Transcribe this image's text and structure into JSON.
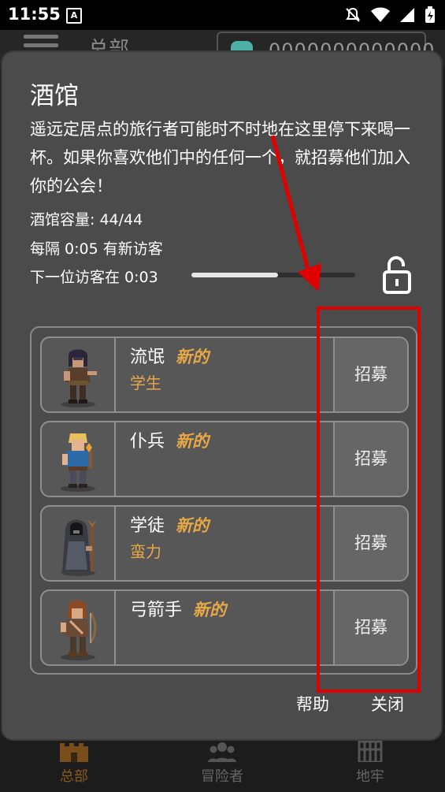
{
  "status_bar": {
    "time": "11:55",
    "a_icon": "A"
  },
  "background": {
    "title": "总部",
    "gems": "0000000000000"
  },
  "bottom_nav": {
    "items": [
      {
        "label": "总部",
        "icon": "castle-icon",
        "color": "#8a5a1e"
      },
      {
        "label": "冒险者",
        "icon": "people-icon",
        "color": "#7a7a7a"
      },
      {
        "label": "地牢",
        "icon": "gate-icon",
        "color": "#7a7a7a"
      }
    ]
  },
  "dialog": {
    "title": "酒馆",
    "description": "遥远定居点的旅行者可能时不时地在这里停下来喝一杯。如果你喜欢他们中的任何一个，就招募他们加入你的公会！",
    "capacity": "酒馆容量: 44/44",
    "interval": "每隔 0:05 有新访客",
    "next_visitor": "下一位访客在 0:03",
    "progress": 0.53,
    "visitors": [
      {
        "name": "流氓",
        "badge": "新的",
        "trait": "学生",
        "recruit": "招募"
      },
      {
        "name": "仆兵",
        "badge": "新的",
        "trait": "",
        "recruit": "招募"
      },
      {
        "name": "学徒",
        "badge": "新的",
        "trait": "蛮力",
        "recruit": "招募"
      },
      {
        "name": "弓箭手",
        "badge": "新的",
        "trait": "",
        "recruit": "招募"
      }
    ],
    "help": "帮助",
    "close": "关闭"
  },
  "colors": {
    "accent": "#e8a845",
    "annotation": "#e00000"
  }
}
